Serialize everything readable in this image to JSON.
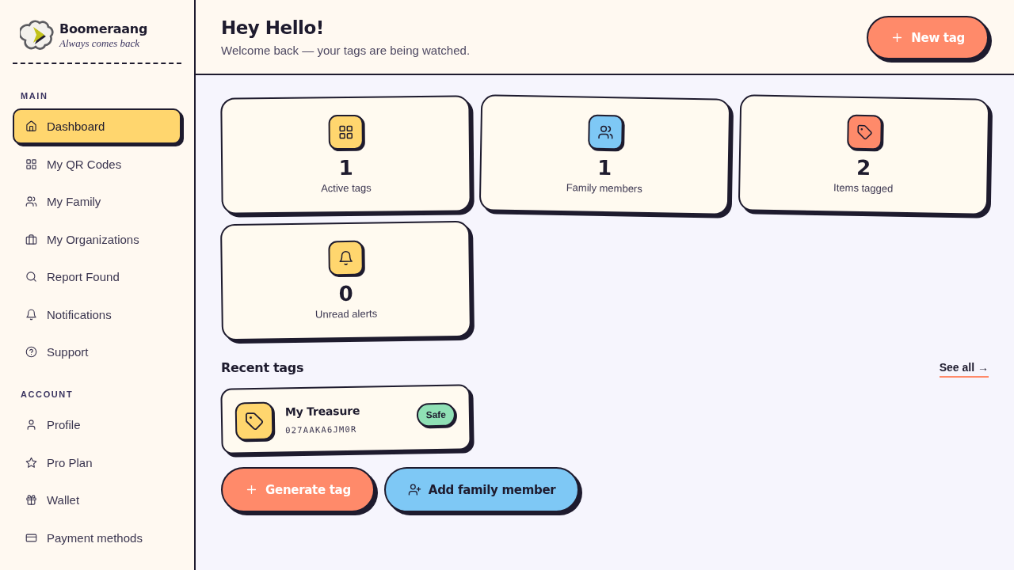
{
  "brand": {
    "name": "Boomeraang",
    "tagline": "Always comes back"
  },
  "sidebar": {
    "sections": [
      {
        "title": "MAIN",
        "items": [
          {
            "label": "Dashboard",
            "selected": true
          },
          {
            "label": "My QR Codes",
            "selected": false
          },
          {
            "label": "My Family",
            "selected": false
          },
          {
            "label": "My Organizations",
            "selected": false
          },
          {
            "label": "Report Found",
            "selected": false
          },
          {
            "label": "Notifications",
            "selected": false
          },
          {
            "label": "Support",
            "selected": false
          }
        ]
      },
      {
        "title": "ACCOUNT",
        "items": [
          {
            "label": "Profile",
            "selected": false
          },
          {
            "label": "Pro Plan",
            "selected": false
          },
          {
            "label": "Wallet",
            "selected": false
          },
          {
            "label": "Payment methods",
            "selected": false
          }
        ]
      }
    ]
  },
  "header": {
    "title": "Hey Hello!",
    "subtitle": "Welcome back — your tags are being watched.",
    "action": {
      "label": "New tag",
      "kind": "primary"
    }
  },
  "stats": [
    {
      "value": "1",
      "label": "Active tags",
      "color": "#ffd66e"
    },
    {
      "value": "1",
      "label": "Family members",
      "color": "#7ec8f5"
    },
    {
      "value": "2",
      "label": "Items tagged",
      "color": "#ff8a6a"
    },
    {
      "value": "0",
      "label": "Unread alerts",
      "color": "#ffd66e"
    }
  ],
  "recent_tags": {
    "title": "Recent tags",
    "link": "See all →",
    "tags": [
      {
        "name": "My Treasure",
        "code": "027AAKA6JM0R",
        "status": "Safe"
      }
    ]
  },
  "actions": [
    {
      "label": "Generate tag",
      "kind": "primary"
    },
    {
      "label": "Add family member",
      "kind": "secondary"
    }
  ]
}
